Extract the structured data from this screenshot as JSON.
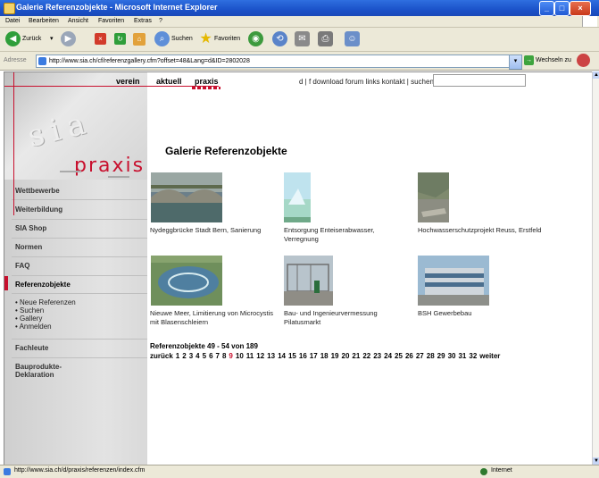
{
  "window": {
    "title": "Galerie Referenzobjekte - Microsoft Internet Explorer"
  },
  "menu": [
    "Datei",
    "Bearbeiten",
    "Ansicht",
    "Favoriten",
    "Extras",
    "?"
  ],
  "toolbar": {
    "back_label": "Zurück",
    "search_label": "Suchen",
    "favorites_label": "Favoriten"
  },
  "address": {
    "label": "Adresse",
    "url": "http://www.sia.ch/cf/referenzgallery.cfm?offset=48&Lang=d&ID=2802028",
    "go_label": "Wechseln zu"
  },
  "status": {
    "url": "http://www.sia.ch/d/praxis/referenzen/index.cfm",
    "zone": "Internet"
  },
  "site": {
    "logo_top": "sia",
    "logo_section": "praxis",
    "topnav": [
      "verein",
      "aktuell",
      "praxis"
    ],
    "toplinks": "d | f  download  forum  links  kontakt  |  suchen",
    "sidebar_items": [
      "Wettbewerbe",
      "Weiterbildung",
      "SIA Shop",
      "Normen",
      "FAQ",
      "Referenzobjekte"
    ],
    "sub_items": [
      "• Neue Referenzen",
      "• Suchen",
      "• Gallery",
      "• Anmelden"
    ],
    "sidebar_lower": [
      "Fachleute",
      "Bauprodukte-",
      "Deklaration"
    ],
    "heading": "Galerie Referenzobjekte",
    "items": [
      {
        "caption": "Nydeggbrücke Stadt Bern, Sanierung"
      },
      {
        "caption": "Entsorgung Enteiserabwasser, Verregnung"
      },
      {
        "caption": "Hochwasserschutzprojekt Reuss, Erstfeld"
      },
      {
        "caption": "Nieuwe Meer, Limitierung von Microcystis mit Blasenschleiern"
      },
      {
        "caption": "Bau- und Ingenieurvermessung Pilatusmarkt"
      },
      {
        "caption": "BSH Gewerbebau"
      }
    ],
    "count_text": "Referenzobjekte 49 - 54 von 189",
    "pager": {
      "prev": "zurück",
      "pages": [
        "1",
        "2",
        "3",
        "4",
        "5",
        "6",
        "7",
        "8",
        "9",
        "10",
        "11",
        "12",
        "13",
        "14",
        "15",
        "16",
        "17",
        "18",
        "19",
        "20",
        "21",
        "22",
        "23",
        "24",
        "25",
        "26",
        "27",
        "28",
        "29",
        "30",
        "31",
        "32"
      ],
      "current": "9",
      "next": "weiter"
    }
  }
}
